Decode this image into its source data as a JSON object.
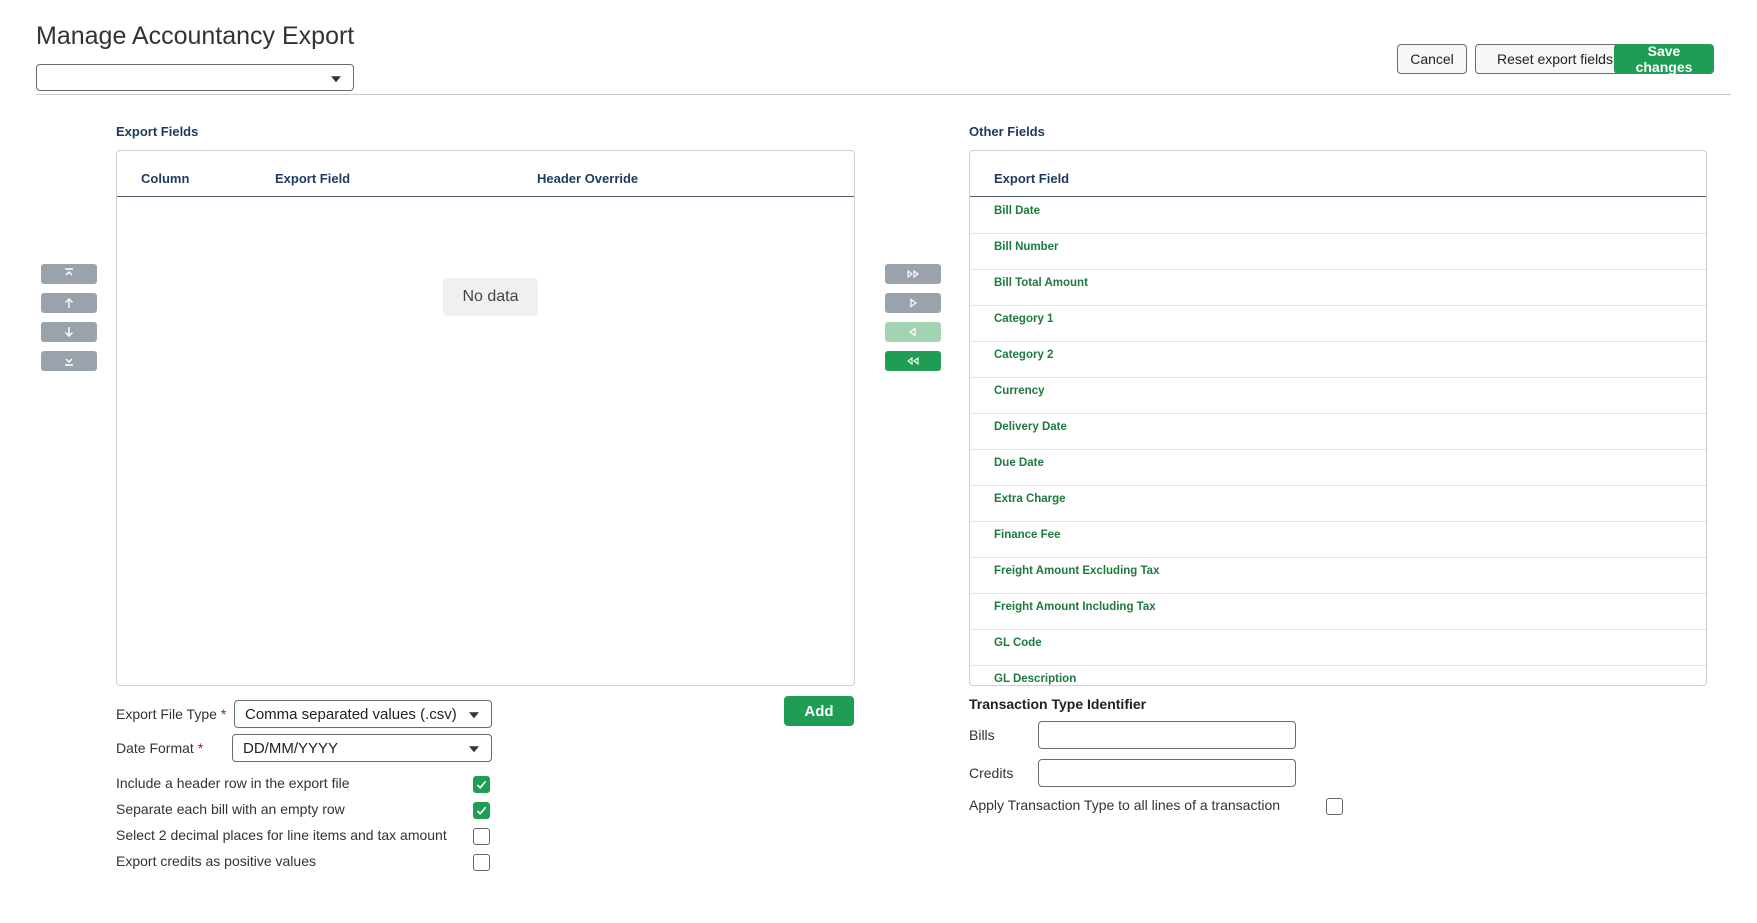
{
  "page": {
    "title": "Manage Accountancy Export",
    "template_select": {
      "value": ""
    }
  },
  "toolbar": {
    "cancel_label": "Cancel",
    "reset_label": "Reset export fields",
    "save_label": "Save changes"
  },
  "export_fields": {
    "title": "Export Fields",
    "columns": [
      "Column",
      "Export Field",
      "Header Override"
    ],
    "empty_text": "No data",
    "add_label": "Add"
  },
  "other_fields": {
    "title": "Other Fields",
    "column": "Export Field",
    "items": [
      "Bill Date",
      "Bill Number",
      "Bill Total Amount",
      "Category 1",
      "Category 2",
      "Currency",
      "Delivery Date",
      "Due Date",
      "Extra Charge",
      "Finance Fee",
      "Freight Amount Excluding Tax",
      "Freight Amount Including Tax",
      "GL Code",
      "GL Description"
    ]
  },
  "order_buttons": [
    "move-to-top-icon",
    "move-up-icon",
    "move-down-icon",
    "move-to-bottom-icon"
  ],
  "transfer_buttons": [
    "move-all-right-icon",
    "move-right-icon",
    "move-left-icon",
    "move-all-left-icon"
  ],
  "settings": {
    "file_type_label": "Export File Type",
    "file_type_value": "Comma separated values (.csv)",
    "date_format_label": "Date Format",
    "date_format_value": "DD/MM/YYYY",
    "required_mark": "*",
    "options": [
      {
        "label": "Include a header row in the export file",
        "checked": true
      },
      {
        "label": "Separate each bill with an empty row",
        "checked": true
      },
      {
        "label": "Select 2 decimal places for line items and tax amount",
        "checked": false
      },
      {
        "label": "Export credits as positive values",
        "checked": false
      }
    ]
  },
  "transaction": {
    "title": "Transaction Type Identifier",
    "bills_label": "Bills",
    "bills_value": "",
    "credits_label": "Credits",
    "credits_value": "",
    "apply_label": "Apply Transaction Type to all lines of a transaction",
    "apply_checked": false
  },
  "colors": {
    "primary": "#1f9d55",
    "field_text": "#1e7a3d",
    "heading": "#1e3a5f",
    "disabled_btn": "#9aa3ab",
    "disabled_primary": "#a3d4b2"
  }
}
